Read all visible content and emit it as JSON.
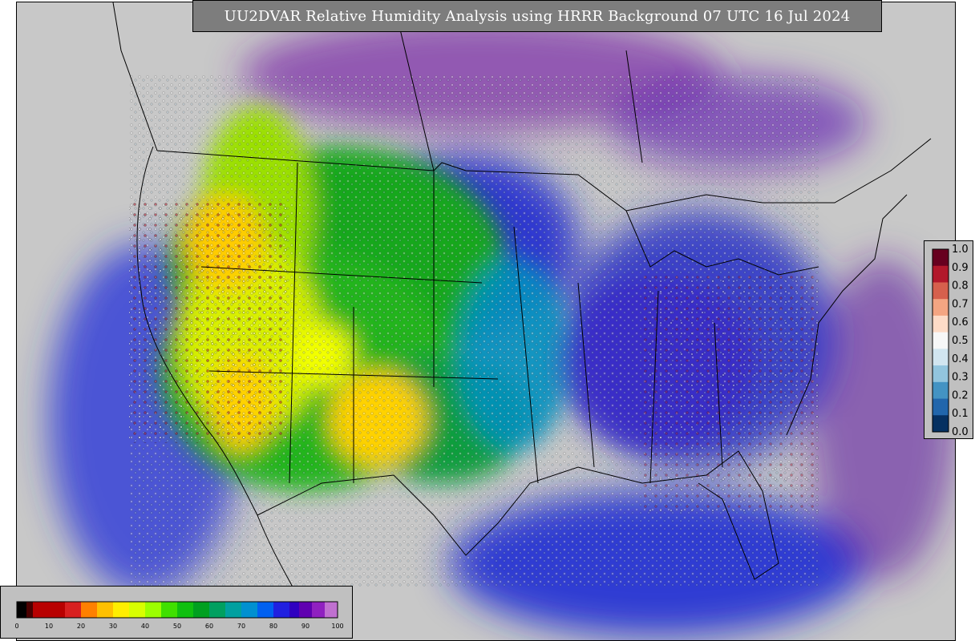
{
  "title": "UU2DVAR Relative Humidity Analysis using HRRR Background 07 UTC 16 Jul 2024",
  "obs_legend": {
    "ticks": [
      "1.0",
      "0.9",
      "0.8",
      "0.7",
      "0.6",
      "0.5",
      "0.4",
      "0.3",
      "0.2",
      "0.1",
      "0.0"
    ],
    "colors": [
      "#67001f",
      "#b2182b",
      "#d6604d",
      "#f4a582",
      "#fddbc7",
      "#f7f7f7",
      "#d1e5f0",
      "#92c5de",
      "#4393c3",
      "#2166ac",
      "#053061"
    ]
  },
  "rh_colorbar": {
    "ticks": [
      "0",
      "10",
      "20",
      "30",
      "40",
      "50",
      "60",
      "70",
      "80",
      "90",
      "100"
    ],
    "range": [
      0,
      100
    ]
  },
  "map": {
    "ocean_color": "#c8c8c8",
    "border_color": "#000000"
  }
}
